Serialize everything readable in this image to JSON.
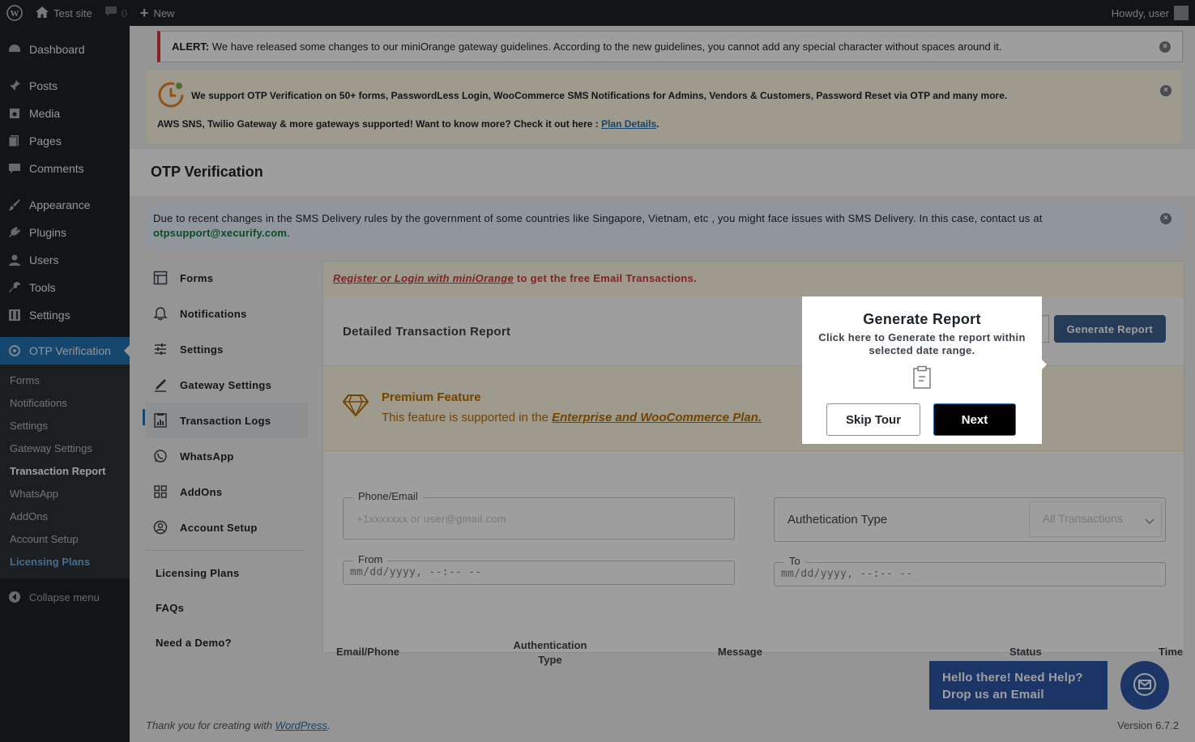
{
  "adminbar": {
    "site_name": "Test site",
    "comments_count": "0",
    "new_label": "New",
    "howdy": "Howdy, user"
  },
  "sidebar": {
    "items": [
      {
        "label": "Dashboard",
        "icon": "dashboard-icon"
      },
      {
        "label": "Posts",
        "icon": "pin-icon"
      },
      {
        "label": "Media",
        "icon": "media-icon"
      },
      {
        "label": "Pages",
        "icon": "pages-icon"
      },
      {
        "label": "Comments",
        "icon": "comment-icon"
      },
      {
        "label": "Appearance",
        "icon": "brush-icon"
      },
      {
        "label": "Plugins",
        "icon": "plug-icon"
      },
      {
        "label": "Users",
        "icon": "user-icon"
      },
      {
        "label": "Tools",
        "icon": "wrench-icon"
      },
      {
        "label": "Settings",
        "icon": "settings-icon"
      },
      {
        "label": "OTP Verification",
        "icon": "otp-icon"
      }
    ],
    "submenu": [
      "Forms",
      "Notifications",
      "Settings",
      "Gateway Settings",
      "Transaction Report",
      "WhatsApp",
      "AddOns",
      "Account Setup",
      "Licensing Plans"
    ],
    "collapse": "Collapse menu"
  },
  "alert": {
    "label": "ALERT:",
    "text": "We have released some changes to our miniOrange gateway guidelines. According to the new guidelines, you cannot add any special character without spaces around it."
  },
  "promo": {
    "line1": "We support OTP Verification on 50+ forms, PasswordLess Login, WooCommerce SMS Notifications for Admins, Vendors & Customers, Password Reset via OTP and many more.",
    "line2": "AWS SNS, Twilio Gateway & more gateways supported! Want to know more? Check it out here :",
    "link": "Plan Details",
    "period": "."
  },
  "page_title": "OTP Verification",
  "sms_notice": {
    "text": "Due to recent changes in the SMS Delivery rules by the government of some countries like Singapore, Vietnam, etc , you might face issues with SMS Delivery. In this case, contact us at",
    "email": "otpsupport@xecurify.com",
    "period": "."
  },
  "plugin_nav": {
    "items": [
      "Forms",
      "Notifications",
      "Settings",
      "Gateway Settings",
      "Transaction Logs",
      "WhatsApp",
      "AddOns",
      "Account Setup"
    ],
    "links": [
      "Licensing Plans",
      "FAQs",
      "Need a Demo?"
    ]
  },
  "register_bar": {
    "link": "Register or Login with miniOrange",
    "text": " to get the free Email Transactions."
  },
  "report": {
    "title": "Detailed Transaction Report",
    "generate_btn": "Generate Report"
  },
  "premium": {
    "title": "Premium Feature",
    "text": "This feature is supported in the ",
    "link": "Enterprise and WooCommerce Plan."
  },
  "filters": {
    "phone_legend": "Phone/Email",
    "phone_placeholder": "+1xxxxxxx or user@gmail.com",
    "auth_type_label": "Authetication Type",
    "auth_type_value": "All Transactions",
    "from_legend": "From",
    "from_value": "mm/dd/yyyy, --:-- --",
    "to_legend": "To",
    "to_value": "mm/dd/yyyy, --:-- --"
  },
  "table": {
    "headers": [
      "Email/Phone",
      "Authentication Type",
      "Message",
      "Status",
      "Time"
    ]
  },
  "help": {
    "line1": "Hello there! Need Help?",
    "line2": "Drop us an Email"
  },
  "footer": {
    "text": "Thank you for creating with ",
    "link": "WordPress",
    "period": ".",
    "version": "Version 6.7.2"
  },
  "tour": {
    "title": "Generate Report",
    "description": "Click here to Generate the report within selected date range.",
    "skip": "Skip Tour",
    "next": "Next"
  },
  "colors": {
    "admin_dark": "#1d2327",
    "accent_blue": "#2271b1",
    "alert_red": "#d63638",
    "premium_orange": "#b86e00",
    "help_blue": "#2c56a6"
  }
}
